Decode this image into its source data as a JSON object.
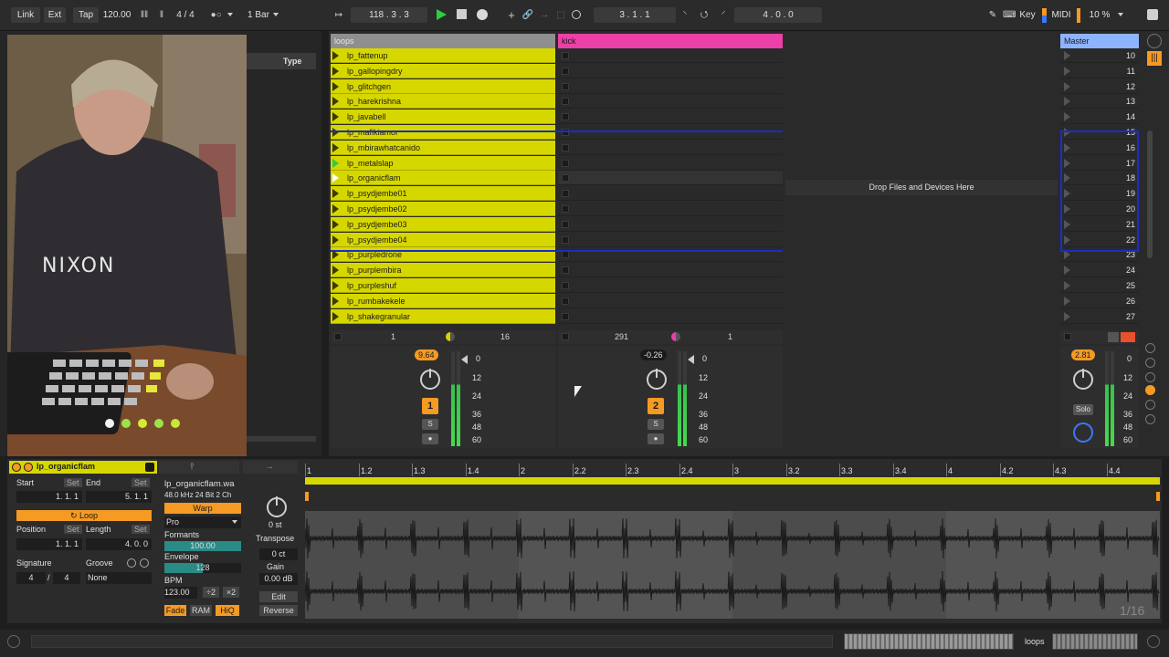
{
  "topbar": {
    "link": "Link",
    "ext": "Ext",
    "tap": "Tap",
    "tempo": "120.00",
    "sig_num": "4",
    "sig_slash": "/",
    "sig_den": "4",
    "quant": "1 Bar",
    "arrangement_pos": "118 .  3 .  3",
    "loop_start": "3 .  1 .  1",
    "loop_len": "4 .  0 .  0",
    "key": "Key",
    "midi": "MIDI",
    "cpu": "10 %"
  },
  "browser": {
    "type_header": "Type"
  },
  "webcam": {
    "hoodie_text": "NIXON"
  },
  "tracks": [
    {
      "name": "loops",
      "color": "#9a9a9a"
    },
    {
      "name": "kick",
      "color": "#ec3fa7"
    },
    {
      "name": "Master",
      "color": "#8fb4ff"
    }
  ],
  "clips": [
    {
      "name": "lp_fattenup"
    },
    {
      "name": "lp_gallopingdry"
    },
    {
      "name": "lp_glitchgen"
    },
    {
      "name": "lp_harekrishna"
    },
    {
      "name": "lp_javabell"
    },
    {
      "name": "lp_mafikiamor"
    },
    {
      "name": "lp_mbirawhatcanido"
    },
    {
      "name": "lp_metalslap"
    },
    {
      "name": "lp_organicflam"
    },
    {
      "name": "lp_psydjembe01"
    },
    {
      "name": "lp_psydjembe02"
    },
    {
      "name": "lp_psydjembe03"
    },
    {
      "name": "lp_psydjembe04"
    },
    {
      "name": "lp_purpledrone"
    },
    {
      "name": "lp_purplembira"
    },
    {
      "name": "lp_purpleshuf"
    },
    {
      "name": "lp_rumbakekele"
    },
    {
      "name": "lp_shakegranular"
    }
  ],
  "scenes": [
    "10",
    "11",
    "12",
    "13",
    "14",
    "15",
    "16",
    "17",
    "18",
    "19",
    "20",
    "21",
    "22",
    "23",
    "24",
    "25",
    "26",
    "27"
  ],
  "drop_text": "Drop Files and Devices Here",
  "loops_footer": {
    "left": "1",
    "right": "16"
  },
  "kick_footer": {
    "left": "291",
    "right": "1"
  },
  "mixer": {
    "loops": {
      "volume": "9.64",
      "number": "1",
      "solo": "S"
    },
    "kick": {
      "volume": "-0.26",
      "number": "2",
      "solo": "S"
    },
    "master": {
      "volume": "2.81",
      "solo": "Solo"
    },
    "db_scale": [
      "0",
      "12",
      "24",
      "36",
      "48",
      "60"
    ]
  },
  "detail": {
    "clip_name": "lp_organicflam",
    "start_label": "Start",
    "end_label": "End",
    "set_label": "Set",
    "start_val": "1.   1.   1",
    "end_val": "5.   1.   1",
    "loop_label": "Loop",
    "position_label": "Position",
    "length_label": "Length",
    "position_val": "1.   1.   1",
    "length_val": "4.   0.   0",
    "signature_label": "Signature",
    "groove_label": "Groove",
    "sig_num": "4",
    "sig_slash": "/",
    "sig_den": "4",
    "groove_val": "None",
    "file_name": "lp_organicflam.wa",
    "file_info": "48.0 kHz  24 Bit  2 Ch",
    "warp": "Warp",
    "warp_mode": "Pro",
    "formants_label": "Formants",
    "formants_val": "100.00",
    "envelope_label": "Envelope",
    "envelope_val": "128",
    "bpm_label": "BPM",
    "bpm_val": "123.00",
    "half": "÷2",
    "double": "×2",
    "fade": "Fade",
    "ram": "RAM",
    "hiq": "HiQ",
    "transpose_val": "0 st",
    "transpose_label": "Transpose",
    "detune_val": "0 ct",
    "gain_label": "Gain",
    "gain_val": "0.00 dB",
    "edit": "Edit",
    "reverse": "Reverse",
    "grid": "1/16",
    "ruler": [
      "1",
      "1.2",
      "1.3",
      "1.4",
      "2",
      "2.2",
      "2.3",
      "2.4",
      "3",
      "3.2",
      "3.3",
      "3.4",
      "4",
      "4.2",
      "4.3",
      "4.4"
    ]
  },
  "status": {
    "track_name": "loops"
  }
}
